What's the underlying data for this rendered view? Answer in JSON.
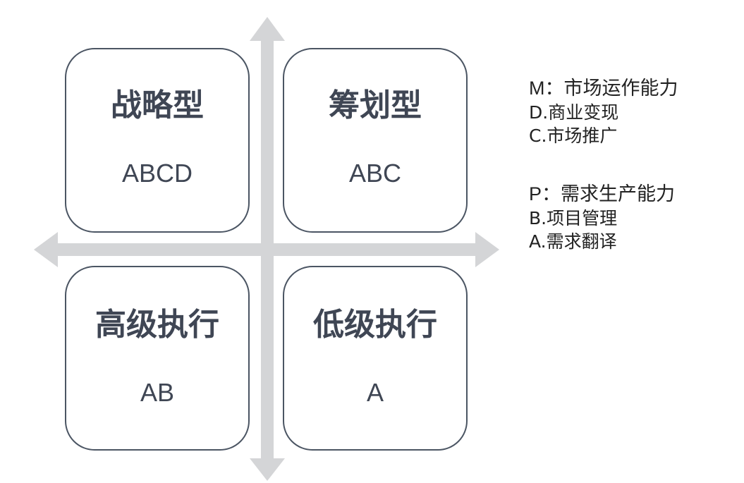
{
  "quadrants": {
    "top_left": {
      "title": "战略型",
      "code": "ABCD"
    },
    "top_right": {
      "title": "筹划型",
      "code": "ABC"
    },
    "bottom_left": {
      "title": "高级执行",
      "code": "AB"
    },
    "bottom_right": {
      "title": "低级执行",
      "code": "A"
    }
  },
  "legend": {
    "m": {
      "code": "M",
      "separator": "：",
      "label": "市场运作能力",
      "items": [
        "D.商业变现",
        "C.市场推广"
      ]
    },
    "p": {
      "code": "P",
      "separator": "：",
      "label": "需求生产能力",
      "items": [
        "B.项目管理",
        "A.需求翻译"
      ]
    }
  },
  "colors": {
    "axis": "#d4d5d7",
    "box_border": "#4b5563",
    "box_text": "#3f4654",
    "legend_text": "#222222"
  }
}
